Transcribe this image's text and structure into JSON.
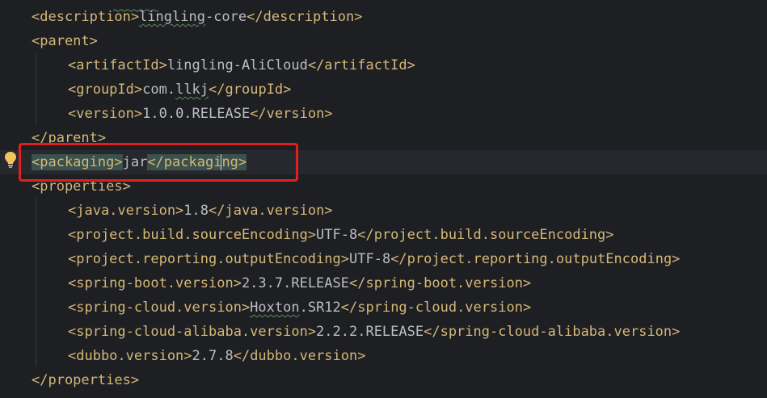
{
  "editor": {
    "lines": [
      {
        "indent": 0,
        "parts": [
          {
            "t": "tag",
            "v": "<description>"
          },
          {
            "t": "squiggle",
            "v": "lingling"
          },
          {
            "t": "txt",
            "v": "-core"
          },
          {
            "t": "tag",
            "v": "</description>"
          }
        ]
      },
      {
        "indent": 0,
        "parts": [
          {
            "t": "tag",
            "v": "<parent>"
          }
        ]
      },
      {
        "indent": 1,
        "parts": [
          {
            "t": "tag",
            "v": "<artifactId>"
          },
          {
            "t": "txt",
            "v": "lingling-AliCloud"
          },
          {
            "t": "tag",
            "v": "</artifactId>"
          }
        ]
      },
      {
        "indent": 1,
        "parts": [
          {
            "t": "tag",
            "v": "<groupId>"
          },
          {
            "t": "txt",
            "v": "com."
          },
          {
            "t": "squiggle",
            "v": "llkj"
          },
          {
            "t": "tag",
            "v": "</groupId>"
          }
        ]
      },
      {
        "indent": 1,
        "parts": [
          {
            "t": "tag",
            "v": "<version>"
          },
          {
            "t": "txt",
            "v": "1.0.0.RELEASE"
          },
          {
            "t": "tag",
            "v": "</version>"
          }
        ]
      },
      {
        "indent": 0,
        "parts": [
          {
            "t": "tag",
            "v": "</parent>"
          }
        ]
      },
      {
        "indent": 0,
        "current": true,
        "parts": [
          {
            "t": "tagmatch",
            "v": "<packaging>"
          },
          {
            "t": "txt",
            "v": "jar"
          },
          {
            "t": "tagmatch",
            "v": "</packagi"
          },
          {
            "t": "caret",
            "v": ""
          },
          {
            "t": "tagmatch",
            "v": "ng>"
          }
        ]
      },
      {
        "indent": 0,
        "parts": [
          {
            "t": "tag",
            "v": "<properties>"
          }
        ]
      },
      {
        "indent": 1,
        "parts": [
          {
            "t": "tag",
            "v": "<java.version>"
          },
          {
            "t": "txt",
            "v": "1.8"
          },
          {
            "t": "tag",
            "v": "</java.version>"
          }
        ]
      },
      {
        "indent": 1,
        "parts": [
          {
            "t": "tag",
            "v": "<project.build.sourceEncoding>"
          },
          {
            "t": "txt",
            "v": "UTF-8"
          },
          {
            "t": "tag",
            "v": "</project.build.sourceEncoding>"
          }
        ]
      },
      {
        "indent": 1,
        "parts": [
          {
            "t": "tag",
            "v": "<project.reporting.outputEncoding>"
          },
          {
            "t": "txt",
            "v": "UTF-8"
          },
          {
            "t": "tag",
            "v": "</project.reporting.outputEncoding>"
          }
        ]
      },
      {
        "indent": 1,
        "parts": [
          {
            "t": "tag",
            "v": "<spring-boot.version>"
          },
          {
            "t": "txt",
            "v": "2.3.7.RELEASE"
          },
          {
            "t": "tag",
            "v": "</spring-boot.version>"
          }
        ]
      },
      {
        "indent": 1,
        "parts": [
          {
            "t": "tag",
            "v": "<spring-cloud.version>"
          },
          {
            "t": "squiggle",
            "v": "Hoxton"
          },
          {
            "t": "txt",
            "v": ".SR12"
          },
          {
            "t": "tag",
            "v": "</spring-cloud.version>"
          }
        ]
      },
      {
        "indent": 1,
        "parts": [
          {
            "t": "tag",
            "v": "<spring-cloud-alibaba.version>"
          },
          {
            "t": "txt",
            "v": "2.2.2.RELEASE"
          },
          {
            "t": "tag",
            "v": "</spring-cloud-alibaba.version>"
          }
        ]
      },
      {
        "indent": 1,
        "parts": [
          {
            "t": "tag",
            "v": "<dubbo.version>"
          },
          {
            "t": "txt",
            "v": "2.7.8"
          },
          {
            "t": "tag",
            "v": "</dubbo.version>"
          }
        ]
      },
      {
        "indent": 0,
        "parts": [
          {
            "t": "tag",
            "v": "</properties>"
          }
        ]
      }
    ]
  },
  "icons": {
    "gutter_hint": "lightbulb-icon"
  },
  "colors": {
    "background": "#1e1f22",
    "tag": "#d5b778",
    "text": "#bcbec4",
    "tag_match_bg": "#3b514d",
    "annotation_box": "#e02020"
  }
}
